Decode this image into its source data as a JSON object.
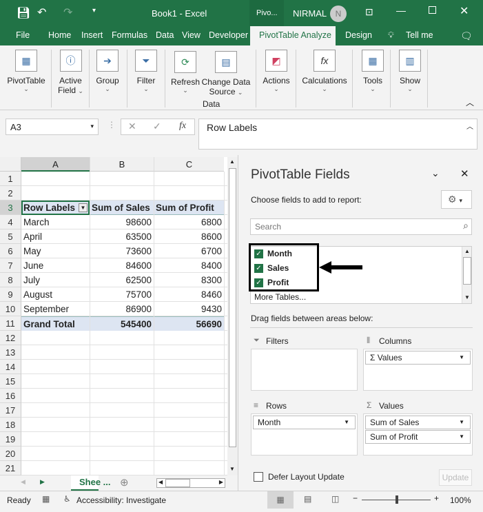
{
  "titlebar": {
    "title": "Book1  -  Excel",
    "context": "Pivo...",
    "user": "NIRMAL",
    "avatar": "N"
  },
  "tabs": [
    "File",
    "Home",
    "Insert",
    "Formulas",
    "Data",
    "View",
    "Developer",
    "PivotTable Analyze",
    "Design",
    "Tell me"
  ],
  "ribbon": {
    "pivottable": "PivotTable",
    "active_field_1": "Active",
    "active_field_2": "Field",
    "group": "Group",
    "filter": "Filter",
    "refresh": "Refresh",
    "change_1": "Change Data",
    "change_2": "Source",
    "data_group": "Data",
    "actions": "Actions",
    "calculations": "Calculations",
    "tools": "Tools",
    "show": "Show"
  },
  "formula": {
    "namebox": "A3",
    "fx": "fx",
    "value": "Row Labels"
  },
  "grid": {
    "columns": [
      "A",
      "B",
      "C"
    ],
    "rows": [
      [
        "",
        "",
        ""
      ],
      [
        "",
        "",
        ""
      ],
      [
        "Row Labels",
        "Sum of Sales",
        "Sum of Profit"
      ],
      [
        "March",
        "98600",
        "6800"
      ],
      [
        "April",
        "63500",
        "8600"
      ],
      [
        "May",
        "73600",
        "6700"
      ],
      [
        "June",
        "84600",
        "8400"
      ],
      [
        "July",
        "62500",
        "8300"
      ],
      [
        "August",
        "75700",
        "8460"
      ],
      [
        "September",
        "86900",
        "9430"
      ],
      [
        "Grand Total",
        "545400",
        "56690"
      ]
    ],
    "row_numbers": [
      "1",
      "2",
      "3",
      "4",
      "5",
      "6",
      "7",
      "8",
      "9",
      "10",
      "11",
      "12",
      "13",
      "14",
      "15",
      "16",
      "17",
      "18",
      "19",
      "20",
      "21"
    ]
  },
  "sheet_tab": "Shee ...",
  "pane": {
    "title": "PivotTable Fields",
    "subtitle": "Choose fields to add to report:",
    "search_placeholder": "Search",
    "fields": [
      {
        "label": "Month",
        "checked": true
      },
      {
        "label": "Sales",
        "checked": true
      },
      {
        "label": "Profit",
        "checked": true
      }
    ],
    "more_tables": "More Tables...",
    "drag_label": "Drag fields between areas below:",
    "areas": {
      "filters": "Filters",
      "columns": "Columns",
      "rows": "Rows",
      "values": "Values"
    },
    "columns_items": [
      "Σ Values"
    ],
    "rows_items": [
      "Month"
    ],
    "values_items": [
      "Sum of Sales",
      "Sum of Profit"
    ],
    "defer": "Defer Layout Update",
    "update": "Update"
  },
  "status": {
    "ready": "Ready",
    "accessibility": "Accessibility: Investigate",
    "zoom": "100%"
  }
}
